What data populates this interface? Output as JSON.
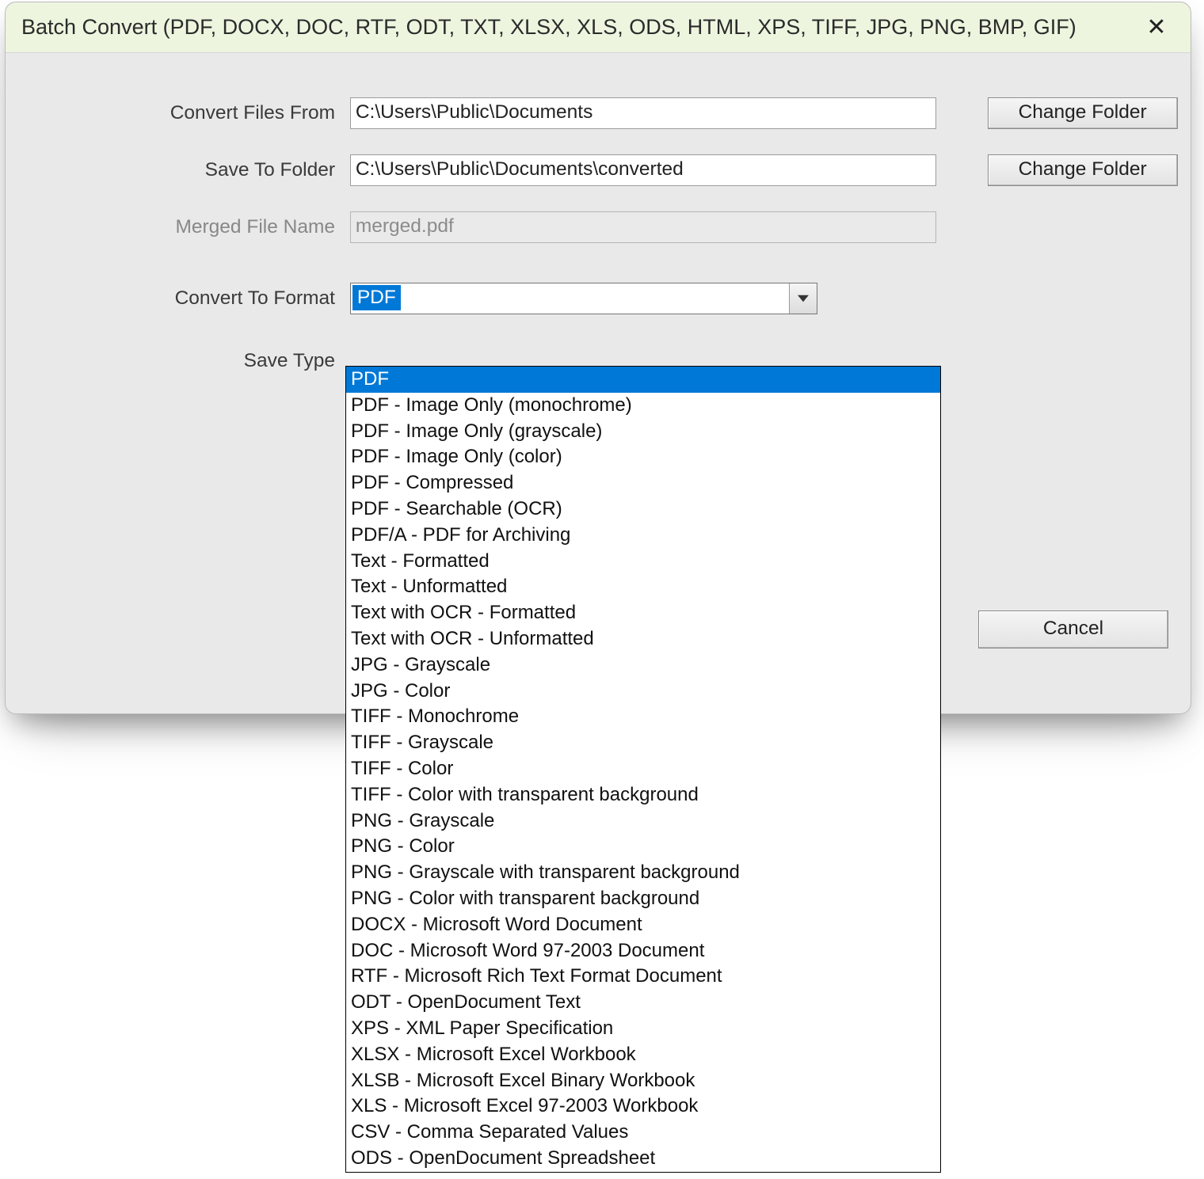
{
  "title": "Batch Convert (PDF, DOCX, DOC, RTF, ODT, TXT, XLSX, XLS, ODS, HTML, XPS, TIFF, JPG, PNG, BMP, GIF)",
  "labels": {
    "convert_from": "Convert Files From",
    "save_to": "Save To Folder",
    "merged": "Merged File Name",
    "format": "Convert To Format",
    "save_type": "Save Type"
  },
  "values": {
    "convert_from": "C:\\Users\\Public\\Documents",
    "save_to": "C:\\Users\\Public\\Documents\\converted",
    "merged": "merged.pdf",
    "format_selected": "PDF"
  },
  "buttons": {
    "change_folder": "Change Folder",
    "cancel": "Cancel"
  },
  "format_options": [
    "PDF",
    "PDF - Image Only (monochrome)",
    "PDF - Image Only (grayscale)",
    "PDF - Image Only (color)",
    "PDF - Compressed",
    "PDF - Searchable (OCR)",
    "PDF/A - PDF for Archiving",
    "Text - Formatted",
    "Text - Unformatted",
    "Text with OCR - Formatted",
    "Text with OCR - Unformatted",
    "JPG - Grayscale",
    "JPG - Color",
    "TIFF - Monochrome",
    "TIFF - Grayscale",
    "TIFF - Color",
    "TIFF - Color with transparent background",
    "PNG - Grayscale",
    "PNG - Color",
    "PNG - Grayscale with transparent background",
    "PNG - Color with transparent background",
    "DOCX - Microsoft Word Document",
    "DOC - Microsoft Word 97-2003 Document",
    "RTF - Microsoft Rich Text Format Document",
    "ODT - OpenDocument Text",
    "XPS - XML Paper Specification",
    "XLSX - Microsoft Excel Workbook",
    "XLSB - Microsoft Excel Binary Workbook",
    "XLS - Microsoft Excel 97-2003 Workbook",
    "CSV - Comma Separated Values",
    "ODS - OpenDocument Spreadsheet"
  ]
}
